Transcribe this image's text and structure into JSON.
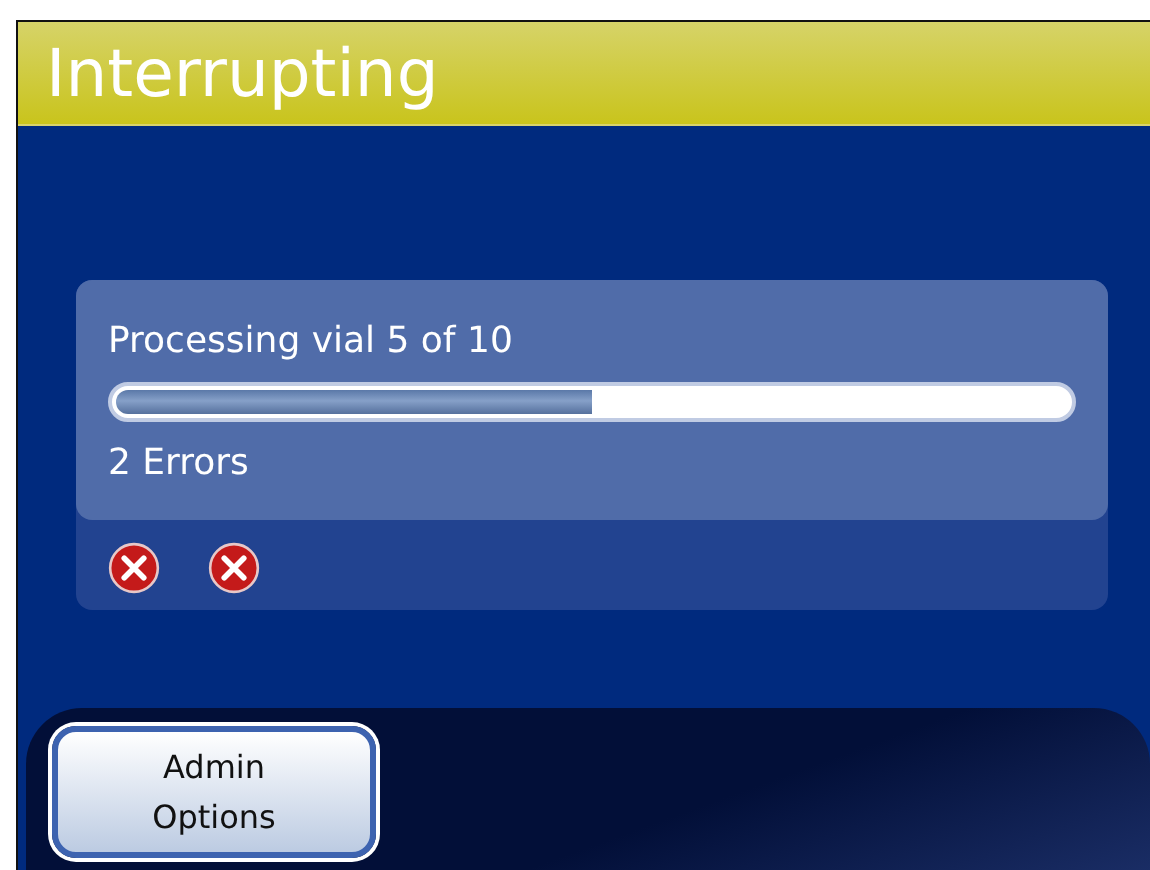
{
  "header": {
    "title": "Interrupting"
  },
  "progress": {
    "label": "Processing vial 5 of 10",
    "level": 0.5,
    "errors_text": "2 Errors"
  },
  "error_icons": [
    {
      "kind": "error"
    },
    {
      "kind": "error"
    }
  ],
  "footer": {
    "button": "Admin\nOptions"
  }
}
